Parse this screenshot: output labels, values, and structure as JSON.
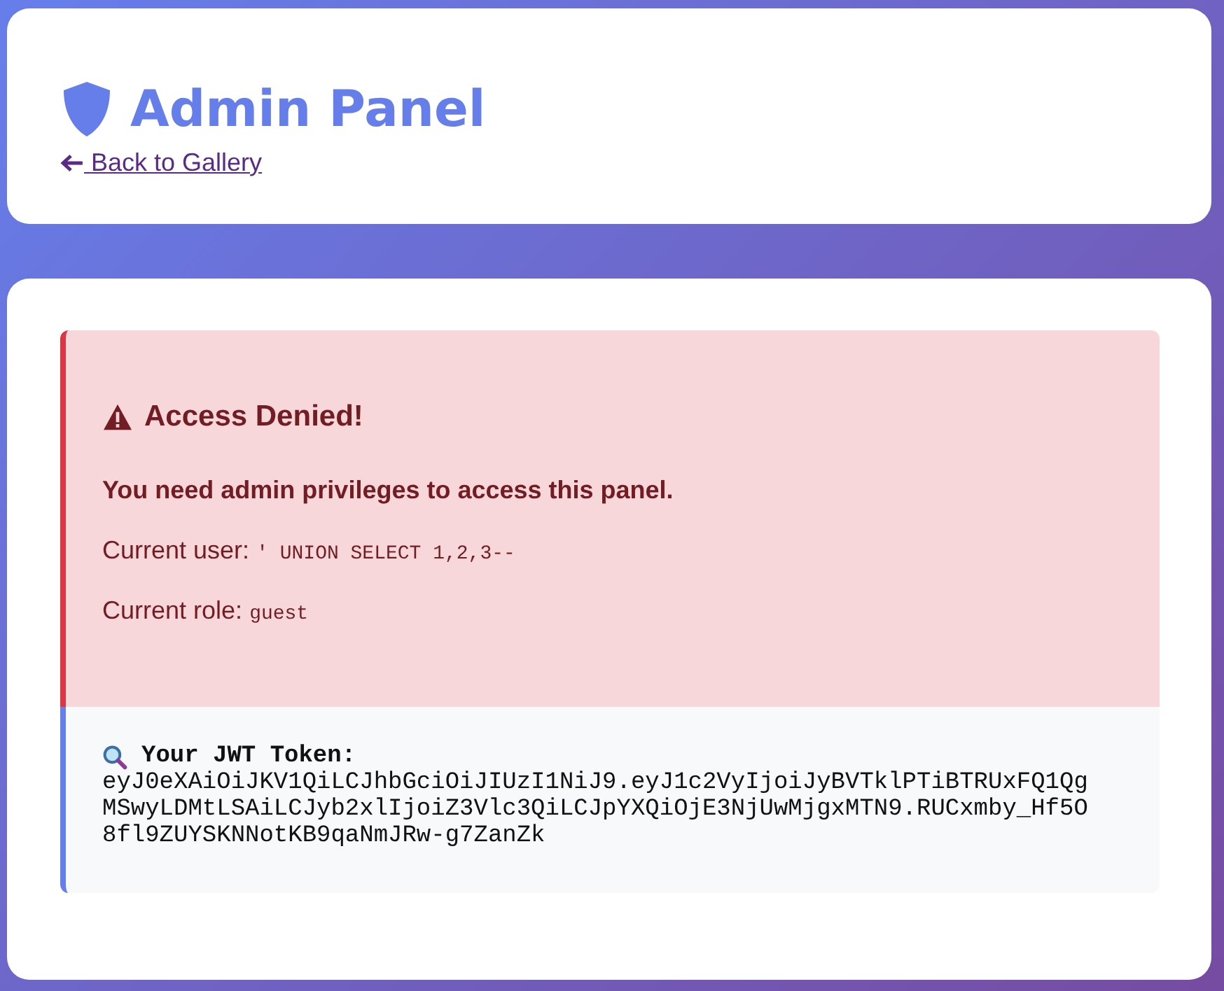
{
  "header": {
    "title": "Admin Panel",
    "back_link": "Back to Gallery"
  },
  "alert": {
    "title": "Access Denied!",
    "message": "You need admin privileges to access this panel.",
    "fields": [
      {
        "label": "Current user:",
        "value": "' UNION SELECT 1,2,3--"
      },
      {
        "label": "Current role:",
        "value": "guest"
      }
    ]
  },
  "token": {
    "label": "Your JWT Token:",
    "value": "eyJ0eXAiOiJKV1QiLCJhbGciOiJIUzI1NiJ9.eyJ1c2VyIjoiJyBVTklPTiBTRUxFQ1QgMSwyLDMtLSAiLCJyb2xlIjoiZ3Vlc3QiLCJpYXQiOjE3NjUwMjgxMTN9.RUCxmby_Hf5O8fl9ZUYSKNNotKB9qaNmJRw-g7ZanZk"
  }
}
